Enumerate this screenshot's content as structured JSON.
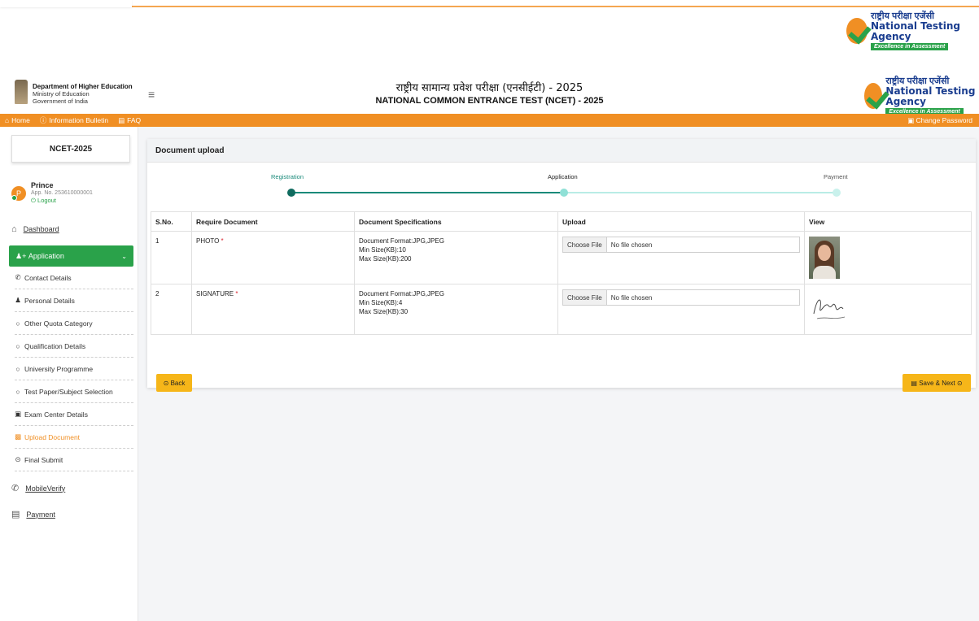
{
  "brand": {
    "nta_hindi": "राष्ट्रीय परीक्षा एजेंसी",
    "nta_english": "National Testing Agency",
    "nta_tagline": "Excellence in Assessment"
  },
  "header": {
    "dept_line1": "Department of Higher Education",
    "dept_line2": "Ministry of Education",
    "dept_line3": "Government of India",
    "title_hindi": "राष्ट्रीय सामान्य प्रवेश परीक्षा (एनसीईटी) - 2025",
    "title_english": "NATIONAL COMMON ENTRANCE TEST (NCET) - 2025"
  },
  "topnav": {
    "home": "Home",
    "info_bulletin": "Information Bulletin",
    "faq": "FAQ",
    "change_password": "Change Password"
  },
  "sidebar": {
    "exam": "NCET-2025",
    "user_name": "Prince",
    "app_no": "App. No. 253610000001",
    "logout": "Logout",
    "avatar_letter": "P",
    "dashboard": "Dashboard",
    "application": "Application",
    "sub_items": [
      {
        "label": "Contact Details",
        "icon": "phone-icon"
      },
      {
        "label": "Personal Details",
        "icon": "person-icon"
      },
      {
        "label": "Other Quota Category",
        "icon": "pin-icon"
      },
      {
        "label": "Qualification Details",
        "icon": "pin-icon"
      },
      {
        "label": "University Programme",
        "icon": "pin-icon"
      },
      {
        "label": "Test Paper/Subject Selection",
        "icon": "pin-icon"
      },
      {
        "label": "Exam Center Details",
        "icon": "building-icon"
      },
      {
        "label": "Upload Document",
        "icon": "upload-icon"
      },
      {
        "label": "Final Submit",
        "icon": "check-circle-icon"
      }
    ],
    "mobile_verify": "MobileVerify",
    "payment": "Payment"
  },
  "main": {
    "card_title": "Document upload",
    "steps": [
      "Registration",
      "Application",
      "Payment"
    ],
    "table": {
      "headers": [
        "S.No.",
        "Require Document",
        "Document Specifications",
        "Upload",
        "View"
      ],
      "rows": [
        {
          "sno": "1",
          "doc": "PHOTO",
          "spec1": "Document Format:JPG,JPEG",
          "spec2": "Min Size(KB):10",
          "spec3": "Max Size(KB):200",
          "choose": "Choose File",
          "file": "No file chosen"
        },
        {
          "sno": "2",
          "doc": "SIGNATURE",
          "spec1": "Document Format:JPG,JPEG",
          "spec2": "Min Size(KB):4",
          "spec3": "Max Size(KB):30",
          "choose": "Choose File",
          "file": "No file chosen"
        }
      ]
    },
    "required_mark": "*",
    "back_label": "Back",
    "save_label": "Save & Next"
  },
  "colors": {
    "orange": "#f08f24",
    "green": "#2aa24a",
    "yellow": "#f6b619",
    "teal": "#1a8a7a"
  }
}
